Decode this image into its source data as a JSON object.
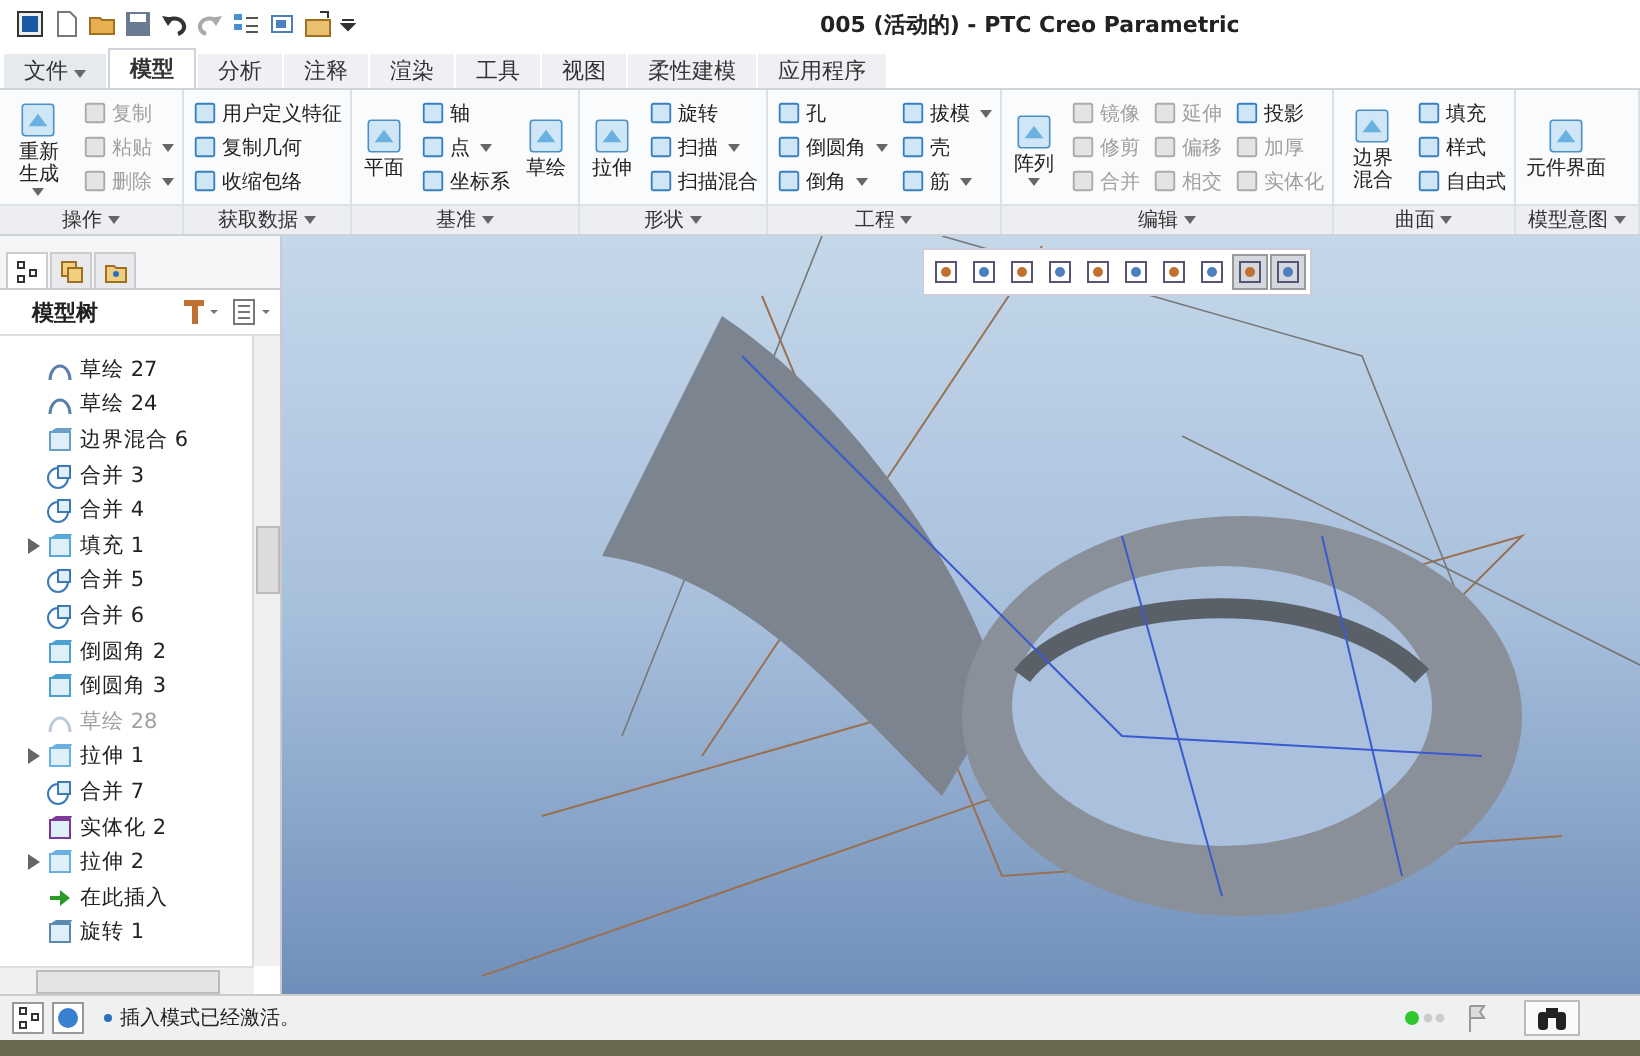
{
  "window": {
    "title": "005 (活动的) - PTC Creo Parametric"
  },
  "tabs": [
    {
      "label": "文件",
      "kind": "menu",
      "selected": false
    },
    {
      "label": "模型",
      "kind": "tab",
      "selected": true
    },
    {
      "label": "分析",
      "kind": "tab",
      "selected": false
    },
    {
      "label": "注释",
      "kind": "tab",
      "selected": false
    },
    {
      "label": "渲染",
      "kind": "tab",
      "selected": false
    },
    {
      "label": "工具",
      "kind": "tab",
      "selected": false
    },
    {
      "label": "视图",
      "kind": "tab",
      "selected": false
    },
    {
      "label": "柔性建模",
      "kind": "tab",
      "selected": false
    },
    {
      "label": "应用程序",
      "kind": "tab",
      "selected": false
    }
  ],
  "ribbon": {
    "groups": [
      {
        "label": "操作",
        "columns": [
          [
            {
              "label": "重新生成",
              "kind": "large",
              "disabled": false,
              "dropdown": true
            }
          ],
          [
            {
              "label": "复制",
              "kind": "small",
              "disabled": true,
              "dropdown": false
            },
            {
              "label": "粘贴",
              "kind": "small",
              "disabled": true,
              "dropdown": true
            },
            {
              "label": "删除",
              "kind": "small",
              "disabled": true,
              "dropdown": true
            }
          ]
        ]
      },
      {
        "label": "获取数据",
        "columns": [
          [
            {
              "label": "用户定义特征",
              "kind": "small",
              "disabled": false,
              "dropdown": false
            },
            {
              "label": "复制几何",
              "kind": "small",
              "disabled": false,
              "dropdown": false
            },
            {
              "label": "收缩包络",
              "kind": "small",
              "disabled": false,
              "dropdown": false
            }
          ]
        ]
      },
      {
        "label": "基准",
        "columns": [
          [
            {
              "label": "平面",
              "kind": "large",
              "disabled": false,
              "dropdown": false
            }
          ],
          [
            {
              "label": "轴",
              "kind": "small",
              "disabled": false,
              "dropdown": false
            },
            {
              "label": "点",
              "kind": "small",
              "disabled": false,
              "dropdown": true
            },
            {
              "label": "坐标系",
              "kind": "small",
              "disabled": false,
              "dropdown": false
            }
          ],
          [
            {
              "label": "草绘",
              "kind": "large",
              "disabled": false,
              "dropdown": false
            }
          ]
        ]
      },
      {
        "label": "形状",
        "columns": [
          [
            {
              "label": "拉伸",
              "kind": "large",
              "disabled": false,
              "dropdown": false
            }
          ],
          [
            {
              "label": "旋转",
              "kind": "small",
              "disabled": false,
              "dropdown": false
            },
            {
              "label": "扫描",
              "kind": "small",
              "disabled": false,
              "dropdown": true
            },
            {
              "label": "扫描混合",
              "kind": "small",
              "disabled": false,
              "dropdown": false
            }
          ]
        ]
      },
      {
        "label": "工程",
        "columns": [
          [
            {
              "label": "孔",
              "kind": "small",
              "disabled": false,
              "dropdown": false
            },
            {
              "label": "倒圆角",
              "kind": "small",
              "disabled": false,
              "dropdown": true
            },
            {
              "label": "倒角",
              "kind": "small",
              "disabled": false,
              "dropdown": true
            }
          ],
          [
            {
              "label": "拔模",
              "kind": "small",
              "disabled": false,
              "dropdown": true
            },
            {
              "label": "壳",
              "kind": "small",
              "disabled": false,
              "dropdown": false
            },
            {
              "label": "筋",
              "kind": "small",
              "disabled": false,
              "dropdown": true
            }
          ]
        ]
      },
      {
        "label": "编辑",
        "columns": [
          [
            {
              "label": "阵列",
              "kind": "large",
              "disabled": false,
              "dropdown": true
            }
          ],
          [
            {
              "label": "镜像",
              "kind": "small",
              "disabled": true,
              "dropdown": false
            },
            {
              "label": "修剪",
              "kind": "small",
              "disabled": true,
              "dropdown": false
            },
            {
              "label": "合并",
              "kind": "small",
              "disabled": true,
              "dropdown": false
            }
          ],
          [
            {
              "label": "延伸",
              "kind": "small",
              "disabled": true,
              "dropdown": false
            },
            {
              "label": "偏移",
              "kind": "small",
              "disabled": true,
              "dropdown": false
            },
            {
              "label": "相交",
              "kind": "small",
              "disabled": true,
              "dropdown": false
            }
          ],
          [
            {
              "label": "投影",
              "kind": "small",
              "disabled": false,
              "dropdown": false
            },
            {
              "label": "加厚",
              "kind": "small",
              "disabled": true,
              "dropdown": false
            },
            {
              "label": "实体化",
              "kind": "small",
              "disabled": true,
              "dropdown": false
            }
          ]
        ]
      },
      {
        "label": "曲面",
        "columns": [
          [
            {
              "label": "边界混合",
              "kind": "large",
              "disabled": false,
              "dropdown": false
            }
          ],
          [
            {
              "label": "填充",
              "kind": "small",
              "disabled": false,
              "dropdown": false
            },
            {
              "label": "样式",
              "kind": "small",
              "disabled": false,
              "dropdown": false
            },
            {
              "label": "自由式",
              "kind": "small",
              "disabled": false,
              "dropdown": false
            }
          ]
        ]
      },
      {
        "label": "模型意图",
        "columns": [
          [
            {
              "label": "元件界面",
              "kind": "large",
              "disabled": false,
              "dropdown": false
            }
          ]
        ]
      }
    ]
  },
  "panel": {
    "tabs": [
      {
        "selected": true
      },
      {
        "selected": false
      },
      {
        "selected": false
      }
    ],
    "title": "模型树",
    "tree": [
      {
        "label": "草绘 27",
        "kind": "sketch",
        "disabled": false,
        "expandable": false
      },
      {
        "label": "草绘 24",
        "kind": "sketch",
        "disabled": false,
        "expandable": false
      },
      {
        "label": "边界混合 6",
        "kind": "blend",
        "disabled": false,
        "expandable": false
      },
      {
        "label": "合并 3",
        "kind": "merge",
        "disabled": false,
        "expandable": false
      },
      {
        "label": "合并 4",
        "kind": "merge",
        "disabled": false,
        "expandable": false
      },
      {
        "label": "填充 1",
        "kind": "fill",
        "disabled": false,
        "expandable": true
      },
      {
        "label": "合并 5",
        "kind": "merge",
        "disabled": false,
        "expandable": false
      },
      {
        "label": "合并 6",
        "kind": "merge",
        "disabled": false,
        "expandable": false
      },
      {
        "label": "倒圆角 2",
        "kind": "round",
        "disabled": false,
        "expandable": false
      },
      {
        "label": "倒圆角 3",
        "kind": "round",
        "disabled": false,
        "expandable": false
      },
      {
        "label": "草绘 28",
        "kind": "sketch",
        "disabled": true,
        "expandable": false
      },
      {
        "label": "拉伸 1",
        "kind": "extrude",
        "disabled": false,
        "expandable": true
      },
      {
        "label": "合并 7",
        "kind": "merge",
        "disabled": false,
        "expandable": false
      },
      {
        "label": "实体化 2",
        "kind": "solidify",
        "disabled": false,
        "expandable": false
      },
      {
        "label": "拉伸 2",
        "kind": "extrude",
        "disabled": false,
        "expandable": true
      },
      {
        "label": "在此插入",
        "kind": "insert",
        "disabled": false,
        "expandable": false
      },
      {
        "label": "旋转 1",
        "kind": "revolve",
        "disabled": false,
        "expandable": false
      }
    ]
  },
  "view_toolbar": [
    {
      "selected": false
    },
    {
      "selected": false
    },
    {
      "selected": false
    },
    {
      "selected": false
    },
    {
      "selected": false
    },
    {
      "selected": false
    },
    {
      "selected": false
    },
    {
      "selected": false
    },
    {
      "selected": true
    },
    {
      "selected": true
    }
  ],
  "status_bar": {
    "message": "插入模式已经激活。"
  }
}
